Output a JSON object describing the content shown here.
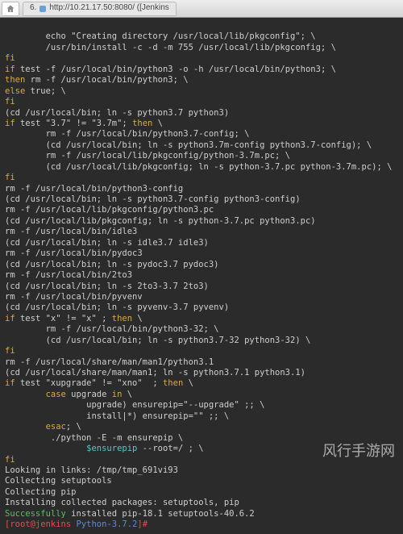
{
  "tab": {
    "index": "6.",
    "url": "http://10.21.17.50:8080/ ([Jenkins"
  },
  "watermark": "风行手游网",
  "term": {
    "l01": "        echo \"Creating directory /usr/local/lib/pkgconfig\"; \\",
    "l02": "        /usr/bin/install -c -d -m 755 /usr/local/lib/pkgconfig; \\",
    "l03": "fi",
    "l04a": "if",
    "l04b": " test -f /usr/local/bin/python3 -o -h /usr/local/bin/python3; \\",
    "l05a": "then",
    "l05b": " rm -f /usr/local/bin/python3; \\",
    "l06a": "else",
    "l06b": " true; \\",
    "l07": "fi",
    "l08": "(cd /usr/local/bin; ln -s python3.7 python3)",
    "l09a": "if",
    "l09b": " test \"3.7\" != \"3.7m\"; ",
    "l09c": "then",
    "l09d": " \\",
    "l10": "        rm -f /usr/local/bin/python3.7-config; \\",
    "l11": "        (cd /usr/local/bin; ln -s python3.7m-config python3.7-config); \\",
    "l12": "        rm -f /usr/local/lib/pkgconfig/python-3.7m.pc; \\",
    "l13": "        (cd /usr/local/lib/pkgconfig; ln -s python-3.7.pc python-3.7m.pc); \\",
    "l14": "fi",
    "l15": "rm -f /usr/local/bin/python3-config",
    "l16": "(cd /usr/local/bin; ln -s python3.7-config python3-config)",
    "l17": "rm -f /usr/local/lib/pkgconfig/python3.pc",
    "l18": "(cd /usr/local/lib/pkgconfig; ln -s python-3.7.pc python3.pc)",
    "l19": "rm -f /usr/local/bin/idle3",
    "l20": "(cd /usr/local/bin; ln -s idle3.7 idle3)",
    "l21": "rm -f /usr/local/bin/pydoc3",
    "l22": "(cd /usr/local/bin; ln -s pydoc3.7 pydoc3)",
    "l23": "rm -f /usr/local/bin/2to3",
    "l24": "(cd /usr/local/bin; ln -s 2to3-3.7 2to3)",
    "l25": "rm -f /usr/local/bin/pyvenv",
    "l26": "(cd /usr/local/bin; ln -s pyvenv-3.7 pyvenv)",
    "l27a": "if",
    "l27b": " test \"x\" != \"x\" ; ",
    "l27c": "then",
    "l27d": " \\",
    "l28": "        rm -f /usr/local/bin/python3-32; \\",
    "l29": "        (cd /usr/local/bin; ln -s python3.7-32 python3-32) \\",
    "l30": "fi",
    "l31": "rm -f /usr/local/share/man/man1/python3.1",
    "l32": "(cd /usr/local/share/man/man1; ln -s python3.7.1 python3.1)",
    "l33a": "if",
    "l33b": " test \"xupgrade\" != \"xno\"  ; ",
    "l33c": "then",
    "l33d": " \\",
    "l34a": "        case",
    "l34b": " upgrade ",
    "l34c": "in",
    "l34d": " \\",
    "l35": "                upgrade) ensurepip=\"--upgrade\" ;; \\",
    "l36": "                install|*) ensurepip=\"\" ;; \\",
    "l37a": "        esac",
    "l37b": "; \\",
    "l38": "         ./python -E -m ensurepip \\",
    "l39a": "                $ensurepip",
    "l39b": " --root=/ ; \\",
    "l40": "fi",
    "l41": "Looking in links: /tmp/tmp_691vi93",
    "l42": "Collecting setuptools",
    "l43": "Collecting pip",
    "l44": "Installing collected packages: setuptools, pip",
    "l45a": "Successfully",
    "l45b": " installed pip-18.1 setuptools-40.6.2",
    "p_user": "[root@jenkins ",
    "p_path": "Python-3.7.2",
    "p_end": "]# "
  }
}
